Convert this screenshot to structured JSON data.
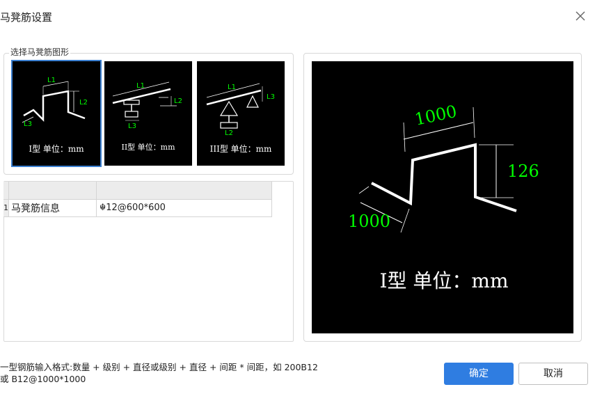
{
  "dialog": {
    "title": "马凳筋设置",
    "group_label": "选择马凳筋图形"
  },
  "shapes": [
    {
      "caption": "I型 单位：mm",
      "labels": [
        "L1",
        "L2",
        "L3"
      ],
      "selected": true
    },
    {
      "caption": "II型 单位：mm",
      "labels": [
        "L1",
        "L2",
        "L3"
      ],
      "selected": false
    },
    {
      "caption": "III型 单位：mm",
      "labels": [
        "L1",
        "L2",
        "L3"
      ],
      "selected": false
    }
  ],
  "grid": {
    "rows": [
      {
        "num": "1",
        "name": "马凳筋信息",
        "value": "☬12@600*600"
      }
    ]
  },
  "preview": {
    "dim_top": "1000",
    "dim_right": "126",
    "dim_left": "1000",
    "caption": "I型 单位：mm"
  },
  "hint": {
    "line1": "一型钢筋输入格式:数量 + 级别 + 直径或级别 + 直径 + 间距 * 间距，如 200B12",
    "line2": "或 B12@1000*1000"
  },
  "buttons": {
    "ok": "确定",
    "cancel": "取消"
  },
  "colors": {
    "accent": "#2f7de1",
    "dimension_green": "#00ff00",
    "canvas_bg": "#000000"
  }
}
